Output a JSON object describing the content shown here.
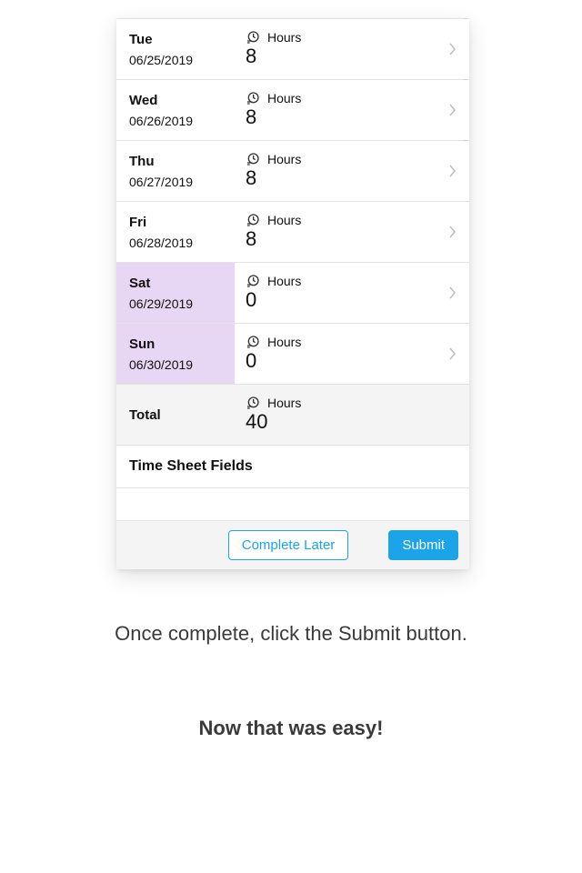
{
  "rows": [
    {
      "day": "Tue",
      "date": "06/25/2019",
      "label": "Hours",
      "value": "8",
      "weekend": false,
      "chevron": true
    },
    {
      "day": "Wed",
      "date": "06/26/2019",
      "label": "Hours",
      "value": "8",
      "weekend": false,
      "chevron": true
    },
    {
      "day": "Thu",
      "date": "06/27/2019",
      "label": "Hours",
      "value": "8",
      "weekend": false,
      "chevron": true
    },
    {
      "day": "Fri",
      "date": "06/28/2019",
      "label": "Hours",
      "value": "8",
      "weekend": false,
      "chevron": true
    },
    {
      "day": "Sat",
      "date": "06/29/2019",
      "label": "Hours",
      "value": "0",
      "weekend": true,
      "chevron": true
    },
    {
      "day": "Sun",
      "date": "06/30/2019",
      "label": "Hours",
      "value": "0",
      "weekend": true,
      "chevron": true
    }
  ],
  "total": {
    "day": "Total",
    "label": "Hours",
    "value": "40"
  },
  "section_header": "Time Sheet Fields",
  "buttons": {
    "complete_later": "Complete Later",
    "submit": "Submit"
  },
  "caption_1": "Once complete, click the Submit button.",
  "caption_2": "Now that was easy!"
}
